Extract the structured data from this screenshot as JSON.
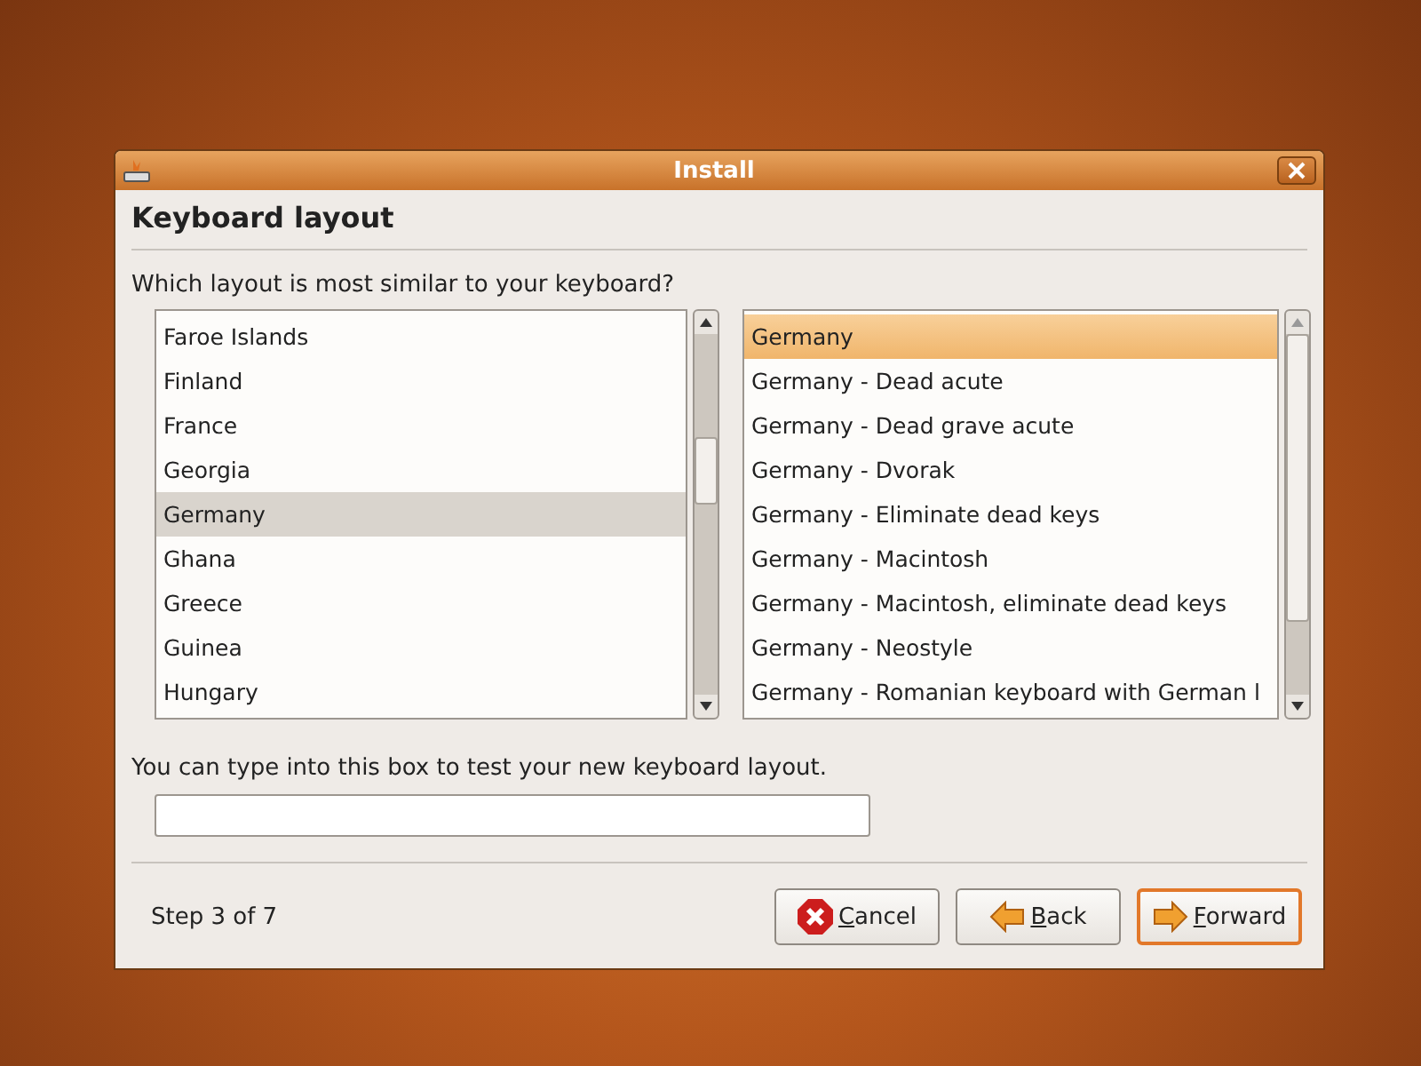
{
  "window": {
    "title": "Install"
  },
  "heading": "Keyboard layout",
  "question": "Which layout is most similar to your keyboard?",
  "countries": [
    {
      "label": "Faroe Islands",
      "selected": false
    },
    {
      "label": "Finland",
      "selected": false
    },
    {
      "label": "France",
      "selected": false
    },
    {
      "label": "Georgia",
      "selected": false
    },
    {
      "label": "Germany",
      "selected": true
    },
    {
      "label": "Ghana",
      "selected": false
    },
    {
      "label": "Greece",
      "selected": false
    },
    {
      "label": "Guinea",
      "selected": false
    },
    {
      "label": "Hungary",
      "selected": false
    }
  ],
  "variants": [
    {
      "label": "Germany",
      "selected": true
    },
    {
      "label": "Germany - Dead acute",
      "selected": false
    },
    {
      "label": "Germany - Dead grave acute",
      "selected": false
    },
    {
      "label": "Germany - Dvorak",
      "selected": false
    },
    {
      "label": "Germany - Eliminate dead keys",
      "selected": false
    },
    {
      "label": "Germany - Macintosh",
      "selected": false
    },
    {
      "label": "Germany - Macintosh, eliminate dead keys",
      "selected": false
    },
    {
      "label": "Germany - Neostyle",
      "selected": false
    },
    {
      "label": "Germany - Romanian keyboard with German l",
      "selected": false
    }
  ],
  "test_label": "You can type into this box to test your new keyboard layout.",
  "step": "Step 3 of 7",
  "buttons": [
    {
      "kind": "cancel",
      "label": "Cancel",
      "default": false
    },
    {
      "kind": "back",
      "label": "Back",
      "default": false
    },
    {
      "kind": "forward",
      "label": "Forward",
      "default": true
    }
  ]
}
